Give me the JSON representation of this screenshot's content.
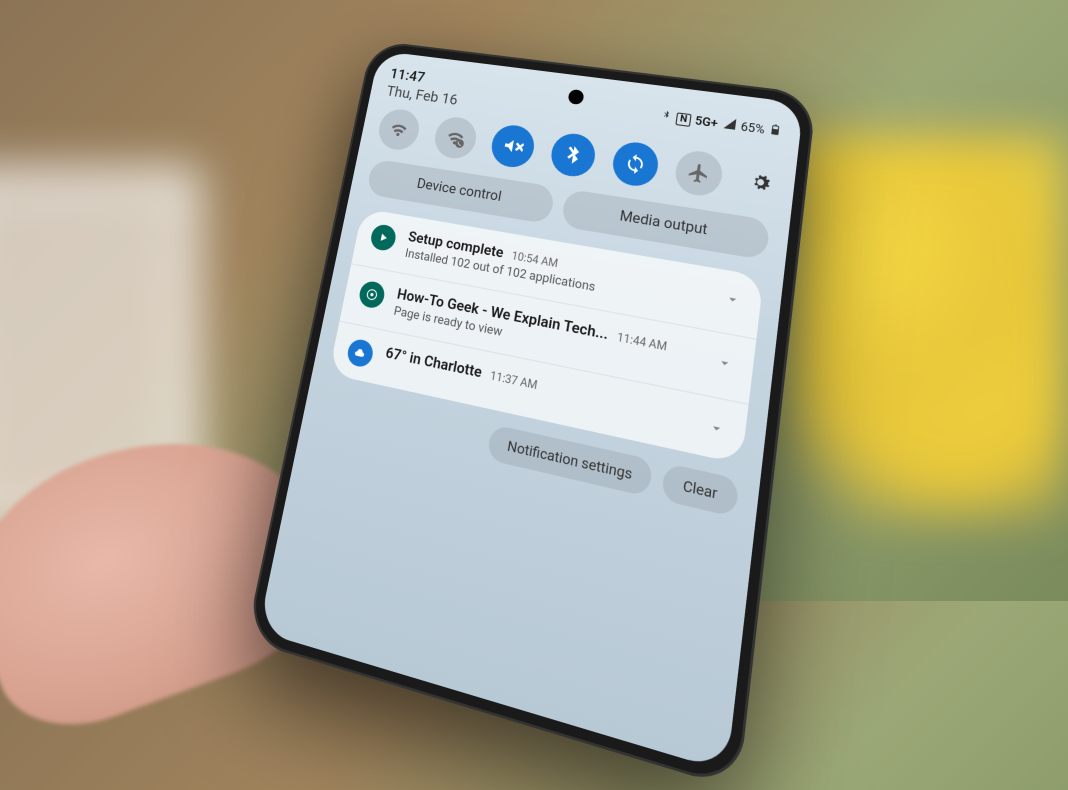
{
  "status": {
    "time": "11:47",
    "date": "Thu, Feb 16",
    "network": "5G+",
    "signal_icon": "signal-icon",
    "nfc_icon": "nfc-icon",
    "bluetooth_icon": "bluetooth-icon",
    "battery_pct": "65%"
  },
  "quick_toggles": [
    {
      "name": "wifi",
      "active": false
    },
    {
      "name": "wifi-calling",
      "active": false
    },
    {
      "name": "sound-mute",
      "active": true
    },
    {
      "name": "bluetooth",
      "active": true
    },
    {
      "name": "auto-rotate",
      "active": true
    },
    {
      "name": "airplane",
      "active": false
    }
  ],
  "controls": {
    "device": "Device control",
    "media": "Media output"
  },
  "notifications": [
    {
      "icon": "play-icon",
      "icon_color": "teal",
      "title": "Setup complete",
      "time": "10:54 AM",
      "body": "Installed 102 out of 102 applications"
    },
    {
      "icon": "chrome-icon",
      "icon_color": "teal",
      "title": "How-To Geek - We Explain Tech...",
      "time": "11:44 AM",
      "body": "Page is ready to view"
    },
    {
      "icon": "cloud-icon",
      "icon_color": "blue",
      "title": "67° in Charlotte",
      "time": "11:37 AM",
      "body": ""
    }
  ],
  "footer": {
    "settings": "Notification settings",
    "clear": "Clear"
  }
}
